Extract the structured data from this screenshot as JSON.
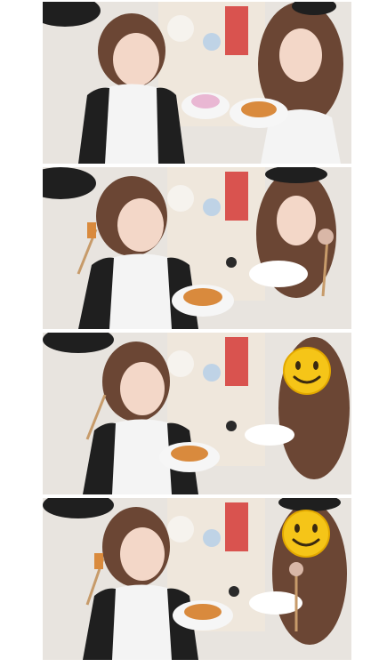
{
  "image": {
    "kind": "photo-collage",
    "panel_count": 4,
    "layout": "vertical-strip",
    "background": "#ffffff",
    "colors": {
      "wall": "#e8e4df",
      "shelf": "#e2d6c4",
      "drawer_red": "#d9534f",
      "shirt_black": "#1f1f1f",
      "shirt_white": "#f4f4f4",
      "hair_brown": "#6b4634",
      "skin": "#f3d7c8",
      "food": "#d98a3d",
      "emoji_yellow": "#f5c518"
    }
  },
  "panels": [
    {
      "id": "panel-1",
      "emoji_cover": false
    },
    {
      "id": "panel-2",
      "emoji_cover": false
    },
    {
      "id": "panel-3",
      "emoji_cover": true
    },
    {
      "id": "panel-4",
      "emoji_cover": true
    }
  ]
}
